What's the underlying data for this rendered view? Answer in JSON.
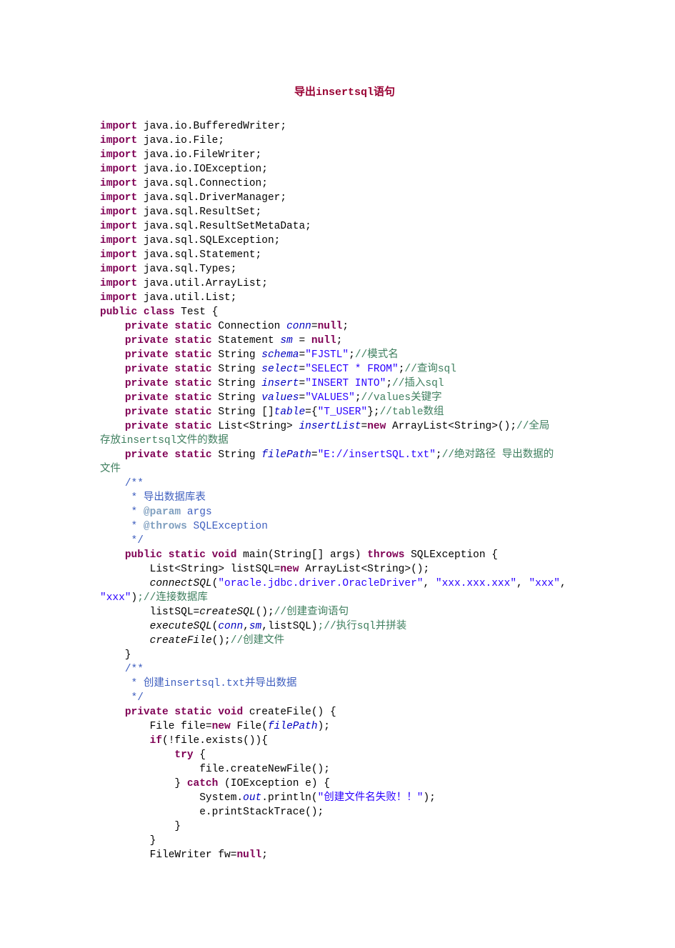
{
  "title": "导出insertsql语句",
  "imports": [
    "java.io.BufferedWriter",
    "java.io.File",
    "java.io.FileWriter",
    "java.io.IOException",
    "java.sql.Connection",
    "java.sql.DriverManager",
    "java.sql.ResultSet",
    "java.sql.ResultSetMetaData",
    "java.sql.SQLException",
    "java.sql.Statement",
    "java.sql.Types",
    "java.util.ArrayList",
    "java.util.List"
  ],
  "classDecl": {
    "keywords": "public class",
    "name": "Test"
  },
  "fields": {
    "conn": {
      "type": "Connection",
      "name": "conn",
      "value": "null",
      "isKeyword": true
    },
    "sm": {
      "type": "Statement",
      "name": "sm",
      "value": "null",
      "isKeyword": true
    },
    "schema": {
      "type": "String",
      "name": "schema",
      "str": "\"FJSTL\"",
      "cmt": "//模式名"
    },
    "select": {
      "type": "String",
      "name": "select",
      "str": "\"SELECT * FROM\"",
      "cmt": "//查询sql"
    },
    "insert": {
      "type": "String",
      "name": "insert",
      "str": "\"INSERT INTO\"",
      "cmt": "//插入sql"
    },
    "values": {
      "type": "String",
      "name": "values",
      "str": "\"VALUES\"",
      "cmt": "//values关键字"
    },
    "table": {
      "type": "String []",
      "name": "table",
      "str": "{\"T_USER\"}",
      "cmt": "//table数组"
    },
    "insertList": {
      "typePre": "List<String>",
      "name": "insertList",
      "newExpr": "ArrayList<String>()",
      "cmtWrap1": "//全局",
      "cmtWrap2": "存放insertsql文件的数据"
    },
    "filePath": {
      "type": "String",
      "name": "filePath",
      "str": "\"E://insertSQL.txt\"",
      "cmtWrap1": "//绝对路径 导出数据的",
      "cmtWrap2": "文件"
    }
  },
  "mainDoc": {
    "l1": "/**",
    "l2": " * 导出数据库表",
    "l3": " * @param args",
    "l4": " * @throws SQLException",
    "l5": " */"
  },
  "mainSig": {
    "pre": "public static void",
    "name": "main",
    "args": "String[] args",
    "throws": "throws",
    "ex": "SQLException"
  },
  "mainBody": {
    "decl1_pre": "List<String> listSQL=",
    "decl1_new": "new",
    "decl1_post": " ArrayList<String>();",
    "connCall_name": "connectSQL",
    "connCall_args": "(\"oracle.jdbc.driver.OracleDriver\", \"xxx.xxx.xxx\", \"xxx\", ",
    "connCall_wrap": "\"xxx\")",
    "connCall_cmt": ";//连接数据库",
    "line3_pre": "listSQL=",
    "line3_call": "createSQL",
    "line3_post": "();",
    "line3_cmt": "//创建查询语句",
    "line4_call": "executeSQL",
    "line4_args": "(conn,sm,listSQL)",
    "line4_cmt": ";//执行sql并拼装",
    "line5_call": "createFile",
    "line5_post": "();",
    "line5_cmt": "//创建文件"
  },
  "createFileDoc": {
    "l1": "/**",
    "l2": " * 创建insertsql.txt并导出数据",
    "l3": " */"
  },
  "createFileSig": {
    "pre": "private static void",
    "name": "createFile"
  },
  "createFileBody": {
    "file_new": "new",
    "file_post": " File(",
    "file_arg": "filePath",
    "if_kw": "if",
    "if_cond": "(!file.exists()){",
    "try_kw": "try",
    "try_post": " {",
    "l_createNew": "file.createNewFile();",
    "catch_kw": "catch",
    "catch_post": " (IOException e) {",
    "sout_pre": "System.",
    "sout_out": "out",
    "sout_mid": ".println(",
    "sout_str": "\"创建文件名失败！！\"",
    "sout_post": ");",
    "l_print": "e.printStackTrace();",
    "fw_decl": "FileWriter fw=",
    "fw_null": "null",
    "fw_end": ";"
  }
}
